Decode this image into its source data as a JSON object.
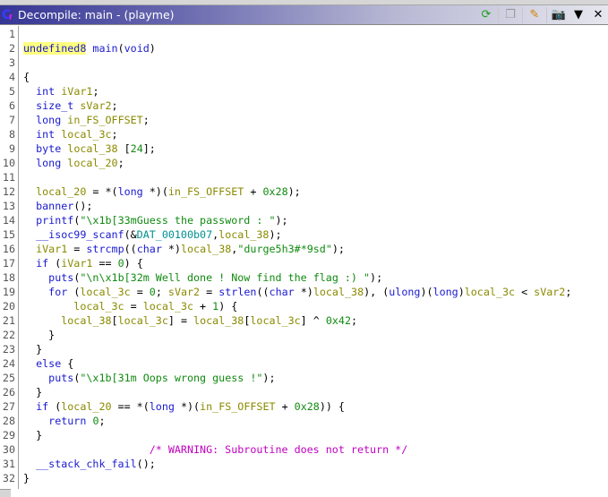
{
  "window": {
    "title": "Decompile: main -  (playme)",
    "toolbar": [
      {
        "name": "refresh-icon",
        "glyph": "⟳",
        "color": "#1aa01a"
      },
      {
        "name": "copy-icon",
        "glyph": "❐",
        "color": "#999999"
      },
      {
        "name": "edit-icon",
        "glyph": "✎",
        "color": "#d08000"
      },
      {
        "name": "snapshot-icon",
        "glyph": "📷",
        "color": "#333333"
      },
      {
        "name": "menu-dropdown-icon",
        "glyph": "▼",
        "color": "#000000"
      },
      {
        "name": "close-icon",
        "glyph": "✕",
        "color": "#000000"
      }
    ]
  },
  "code": {
    "lines": [
      [],
      [
        [
          "undefined8",
          "t hl"
        ],
        [
          " ",
          ""
        ],
        [
          "main",
          "f"
        ],
        [
          "(",
          ""
        ],
        [
          "void",
          "t"
        ],
        [
          ")",
          ""
        ]
      ],
      [],
      [
        [
          "{",
          ""
        ]
      ],
      [
        [
          "  ",
          ""
        ],
        [
          "int",
          "t"
        ],
        [
          " ",
          ""
        ],
        [
          "iVar1",
          "v"
        ],
        [
          ";",
          ""
        ]
      ],
      [
        [
          "  ",
          ""
        ],
        [
          "size_t",
          "t"
        ],
        [
          " ",
          ""
        ],
        [
          "sVar2",
          "v"
        ],
        [
          ";",
          ""
        ]
      ],
      [
        [
          "  ",
          ""
        ],
        [
          "long",
          "t"
        ],
        [
          " ",
          ""
        ],
        [
          "in_FS_OFFSET",
          "v"
        ],
        [
          ";",
          ""
        ]
      ],
      [
        [
          "  ",
          ""
        ],
        [
          "int",
          "t"
        ],
        [
          " ",
          ""
        ],
        [
          "local_3c",
          "v"
        ],
        [
          ";",
          ""
        ]
      ],
      [
        [
          "  ",
          ""
        ],
        [
          "byte",
          "t"
        ],
        [
          " ",
          ""
        ],
        [
          "local_38",
          "v"
        ],
        [
          " [",
          ""
        ],
        [
          "24",
          "s"
        ],
        [
          "];",
          ""
        ]
      ],
      [
        [
          "  ",
          ""
        ],
        [
          "long",
          "t"
        ],
        [
          " ",
          ""
        ],
        [
          "local_20",
          "v"
        ],
        [
          ";",
          ""
        ]
      ],
      [],
      [
        [
          "  ",
          ""
        ],
        [
          "local_20",
          "v"
        ],
        [
          " = *(",
          ""
        ],
        [
          "long",
          "t"
        ],
        [
          " *)(",
          ""
        ],
        [
          "in_FS_OFFSET",
          "v"
        ],
        [
          " + ",
          ""
        ],
        [
          "0x28",
          "s"
        ],
        [
          ");",
          ""
        ]
      ],
      [
        [
          "  ",
          ""
        ],
        [
          "banner",
          "f"
        ],
        [
          "();",
          ""
        ]
      ],
      [
        [
          "  ",
          ""
        ],
        [
          "printf",
          "f"
        ],
        [
          "(",
          ""
        ],
        [
          "\"\\x1b[33mGuess the password : \"",
          "s"
        ],
        [
          ");",
          ""
        ]
      ],
      [
        [
          "  ",
          ""
        ],
        [
          "__isoc99_scanf",
          "f"
        ],
        [
          "(&",
          ""
        ],
        [
          "DAT_00100b07",
          "d"
        ],
        [
          ",",
          ""
        ],
        [
          "local_38",
          "v"
        ],
        [
          ");",
          ""
        ]
      ],
      [
        [
          "  ",
          ""
        ],
        [
          "iVar1",
          "v"
        ],
        [
          " = ",
          ""
        ],
        [
          "strcmp",
          "f"
        ],
        [
          "((",
          ""
        ],
        [
          "char",
          "t"
        ],
        [
          " *)",
          ""
        ],
        [
          "local_38",
          "v"
        ],
        [
          ",",
          ""
        ],
        [
          "\"durge5h3#*9sd\"",
          "s"
        ],
        [
          ");",
          ""
        ]
      ],
      [
        [
          "  ",
          ""
        ],
        [
          "if",
          "k"
        ],
        [
          " (",
          ""
        ],
        [
          "iVar1",
          "v"
        ],
        [
          " == ",
          ""
        ],
        [
          "0",
          "s"
        ],
        [
          ") {",
          ""
        ]
      ],
      [
        [
          "    ",
          ""
        ],
        [
          "puts",
          "f"
        ],
        [
          "(",
          ""
        ],
        [
          "\"\\n\\x1b[32m Well done ! Now find the flag :) \"",
          "s"
        ],
        [
          ");",
          ""
        ]
      ],
      [
        [
          "    ",
          ""
        ],
        [
          "for",
          "k"
        ],
        [
          " (",
          ""
        ],
        [
          "local_3c",
          "v"
        ],
        [
          " = ",
          ""
        ],
        [
          "0",
          "s"
        ],
        [
          "; ",
          ""
        ],
        [
          "sVar2",
          "v"
        ],
        [
          " = ",
          ""
        ],
        [
          "strlen",
          "f"
        ],
        [
          "((",
          ""
        ],
        [
          "char",
          "t"
        ],
        [
          " *)",
          ""
        ],
        [
          "local_38",
          "v"
        ],
        [
          "), (",
          ""
        ],
        [
          "ulong",
          "t"
        ],
        [
          ")(",
          ""
        ],
        [
          "long",
          "t"
        ],
        [
          ")",
          ""
        ],
        [
          "local_3c",
          "v"
        ],
        [
          " < ",
          ""
        ],
        [
          "sVar2",
          "v"
        ],
        [
          ";",
          ""
        ]
      ],
      [
        [
          "        ",
          ""
        ],
        [
          "local_3c",
          "v"
        ],
        [
          " = ",
          ""
        ],
        [
          "local_3c",
          "v"
        ],
        [
          " + ",
          ""
        ],
        [
          "1",
          "s"
        ],
        [
          ") {",
          ""
        ]
      ],
      [
        [
          "      ",
          ""
        ],
        [
          "local_38",
          "v"
        ],
        [
          "[",
          ""
        ],
        [
          "local_3c",
          "v"
        ],
        [
          "] = ",
          ""
        ],
        [
          "local_38",
          "v"
        ],
        [
          "[",
          ""
        ],
        [
          "local_3c",
          "v"
        ],
        [
          "] ^ ",
          ""
        ],
        [
          "0x42",
          "s"
        ],
        [
          ";",
          ""
        ]
      ],
      [
        [
          "    }",
          ""
        ]
      ],
      [
        [
          "  }",
          ""
        ]
      ],
      [
        [
          "  ",
          ""
        ],
        [
          "else",
          "k"
        ],
        [
          " {",
          ""
        ]
      ],
      [
        [
          "    ",
          ""
        ],
        [
          "puts",
          "f"
        ],
        [
          "(",
          ""
        ],
        [
          "\"\\x1b[31m Oops wrong guess !\"",
          "s"
        ],
        [
          ");",
          ""
        ]
      ],
      [
        [
          "  }",
          ""
        ]
      ],
      [
        [
          "  ",
          ""
        ],
        [
          "if",
          "k"
        ],
        [
          " (",
          ""
        ],
        [
          "local_20",
          "v"
        ],
        [
          " == *(",
          ""
        ],
        [
          "long",
          "t"
        ],
        [
          " *)(",
          ""
        ],
        [
          "in_FS_OFFSET",
          "v"
        ],
        [
          " + ",
          ""
        ],
        [
          "0x28",
          "s"
        ],
        [
          ")) {",
          ""
        ]
      ],
      [
        [
          "    ",
          ""
        ],
        [
          "return",
          "k"
        ],
        [
          " ",
          ""
        ],
        [
          "0",
          "s"
        ],
        [
          ";",
          ""
        ]
      ],
      [
        [
          "  }",
          ""
        ]
      ],
      [
        [
          "                    ",
          ""
        ],
        [
          "/* WARNING: Subroutine does not return */",
          "c"
        ]
      ],
      [
        [
          "  ",
          ""
        ],
        [
          "__stack_chk_fail",
          "f"
        ],
        [
          "();",
          ""
        ]
      ],
      [
        [
          "}",
          ""
        ]
      ]
    ]
  }
}
